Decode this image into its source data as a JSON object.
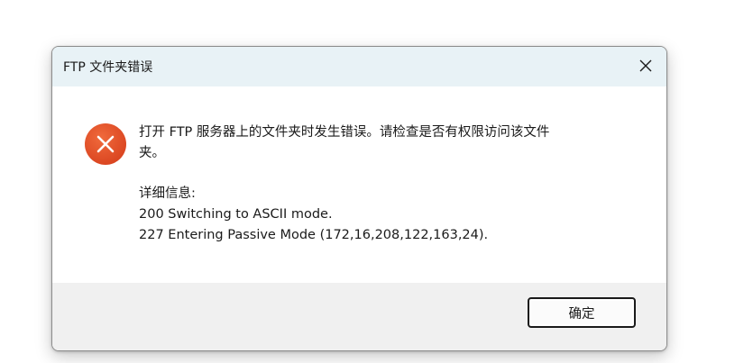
{
  "dialog": {
    "title": "FTP 文件夹错误",
    "close_icon": "close-icon",
    "error_icon": "error-icon",
    "message_line1": "打开 FTP 服务器上的文件夹时发生错误。请检查是否有权限访问该文件",
    "message_line2": "夹。",
    "details_heading": "详细信息:",
    "details_lines": [
      "200 Switching to ASCII mode.",
      "227 Entering Passive Mode (172,16,208,122,163,24)."
    ],
    "ok_label": "确定"
  },
  "colors": {
    "titlebar_bg": "#e8f2f6",
    "footer_bg": "#f0f0f0",
    "error_icon_color": "#e04e2a"
  }
}
